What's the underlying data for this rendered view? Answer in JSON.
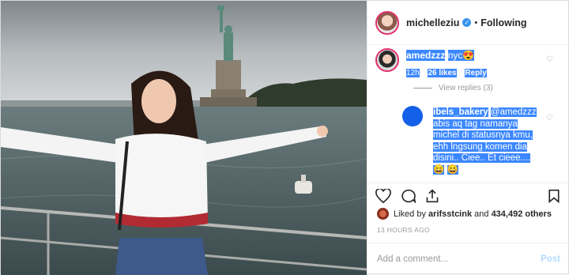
{
  "header": {
    "username": "michelleziu",
    "verified_icon": "verified-badge-icon",
    "separator": "•",
    "follow_status": "Following"
  },
  "comments": [
    {
      "username": "amedzzz",
      "text": "nyc",
      "emoji": "😍",
      "time": "12h",
      "likes": "26 likes",
      "reply": "Reply",
      "view_replies": "View replies (3)"
    },
    {
      "username": "ibels_bakery",
      "mention": "@amedzzz",
      "text": "abis aq tag namanya michel di statusnya kmu, ehh lngsung komen dia disini.. Ciee.. Et cieee....",
      "emoji1": "😄",
      "emoji2": "😄"
    }
  ],
  "likes": {
    "prefix": "Liked by",
    "user": "arifsstcink",
    "conjunction": "and",
    "others": "434,492 others"
  },
  "timestamp": "13 HOURS AGO",
  "add_comment": {
    "placeholder": "Add a comment...",
    "post_label": "Post"
  },
  "colors": {
    "highlight": "#3b87ff",
    "verified": "#3897f0",
    "post_disabled": "#b3dbff"
  }
}
